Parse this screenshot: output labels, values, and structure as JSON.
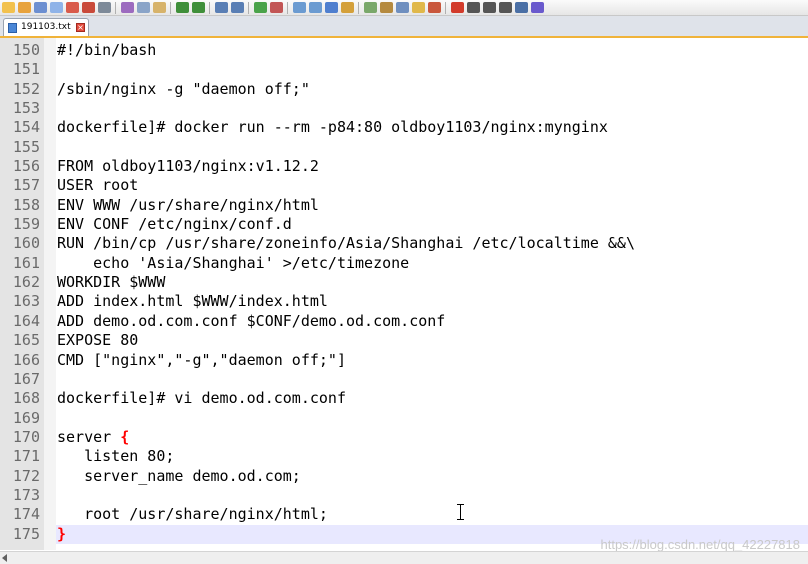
{
  "toolbar": {
    "buttons": [
      "new-file-icon",
      "open-file-icon",
      "save-icon",
      "save-all-icon",
      "close-icon",
      "close-all-icon",
      "print-icon",
      "cut-icon",
      "copy-icon",
      "paste-icon",
      "undo-icon",
      "redo-icon",
      "find-icon",
      "replace-icon",
      "zoom-in-icon",
      "zoom-out-icon",
      "sync-vertical-icon",
      "sync-horizontal-icon",
      "word-wrap-icon",
      "show-all-chars-icon",
      "indent-guide-icon",
      "doc-map-icon",
      "function-list-icon",
      "folder-as-workspace-icon",
      "monitoring-icon",
      "record-macro-icon",
      "stop-macro-icon",
      "play-macro-icon",
      "run-macro-multiple-icon",
      "save-macro-icon",
      "spell-check-icon"
    ]
  },
  "tab": {
    "label": "191103.txt",
    "close_glyph": "×"
  },
  "editor": {
    "current_line": 175,
    "lines": [
      {
        "num": "150",
        "text": "#!/bin/bash"
      },
      {
        "num": "151",
        "text": ""
      },
      {
        "num": "152",
        "text": "/sbin/nginx -g \"daemon off;\""
      },
      {
        "num": "153",
        "text": ""
      },
      {
        "num": "154",
        "text": "dockerfile]# docker run --rm -p84:80 oldboy1103/nginx:mynginx"
      },
      {
        "num": "155",
        "text": ""
      },
      {
        "num": "156",
        "text": "FROM oldboy1103/nginx:v1.12.2"
      },
      {
        "num": "157",
        "text": "USER root"
      },
      {
        "num": "158",
        "text": "ENV WWW /usr/share/nginx/html"
      },
      {
        "num": "159",
        "text": "ENV CONF /etc/nginx/conf.d"
      },
      {
        "num": "160",
        "text": "RUN /bin/cp /usr/share/zoneinfo/Asia/Shanghai /etc/localtime &&\\"
      },
      {
        "num": "161",
        "text": "    echo 'Asia/Shanghai' >/etc/timezone"
      },
      {
        "num": "162",
        "text": "WORKDIR $WWW"
      },
      {
        "num": "163",
        "text": "ADD index.html $WWW/index.html"
      },
      {
        "num": "164",
        "text": "ADD demo.od.com.conf $CONF/demo.od.com.conf"
      },
      {
        "num": "165",
        "text": "EXPOSE 80"
      },
      {
        "num": "166",
        "text": "CMD [\"nginx\",\"-g\",\"daemon off;\"]"
      },
      {
        "num": "167",
        "text": ""
      },
      {
        "num": "168",
        "text": "dockerfile]# vi demo.od.com.conf"
      },
      {
        "num": "169",
        "text": ""
      },
      {
        "num": "170",
        "text": "server ",
        "brace": "{"
      },
      {
        "num": "171",
        "text": "   listen 80;"
      },
      {
        "num": "172",
        "text": "   server_name demo.od.com;"
      },
      {
        "num": "173",
        "text": ""
      },
      {
        "num": "174",
        "text": "   root /usr/share/nginx/html;"
      },
      {
        "num": "175",
        "text": "",
        "brace": "}"
      }
    ]
  },
  "watermark": "https://blog.csdn.net/qq_42227818",
  "colors": {
    "tab_accent": "#f0b33a",
    "brace": "#ff0000",
    "gutter": "#e4e4e4",
    "current_line": "#e8e8ff"
  }
}
